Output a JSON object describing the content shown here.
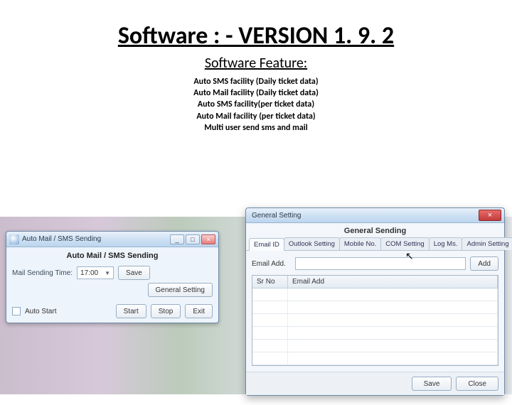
{
  "page": {
    "title": "Software : - VERSION 1. 9. 2",
    "subtitle": "Software Feature:",
    "features": [
      "Auto SMS facility (Daily ticket data)",
      "Auto Mail facility (Daily ticket data)",
      "Auto SMS facility(per ticket data)",
      "Auto Mail facility (per ticket data)",
      "Multi user send sms and mail"
    ]
  },
  "smallWin": {
    "title": "Auto Mail / SMS Sending",
    "banner": "Auto Mail / SMS Sending",
    "timeLabel": "Mail Sending Time:",
    "timeValue": "17:00",
    "saveBtn": "Save",
    "generalSettingBtn": "General Setting",
    "autoStartLabel": "Auto Start",
    "startBtn": "Start",
    "stopBtn": "Stop",
    "exitBtn": "Exit",
    "ctrlMin": "_",
    "ctrlMax": "□",
    "ctrlClose": "×"
  },
  "bigWin": {
    "title": "General Setting",
    "closeGlyph": "×",
    "sectionHeader": "General Sending",
    "tabs": [
      "Email ID",
      "Outlook Setting",
      "Mobile No.",
      "COM Setting",
      "Log Ms.",
      "Admin Setting"
    ],
    "activeTab": 0,
    "emailAddLabel": "Email Add.",
    "addBtn": "Add",
    "grid": {
      "cols": [
        "Sr No",
        "Email Add"
      ],
      "rows": []
    },
    "saveBtn": "Save",
    "closeBtn": "Close"
  }
}
